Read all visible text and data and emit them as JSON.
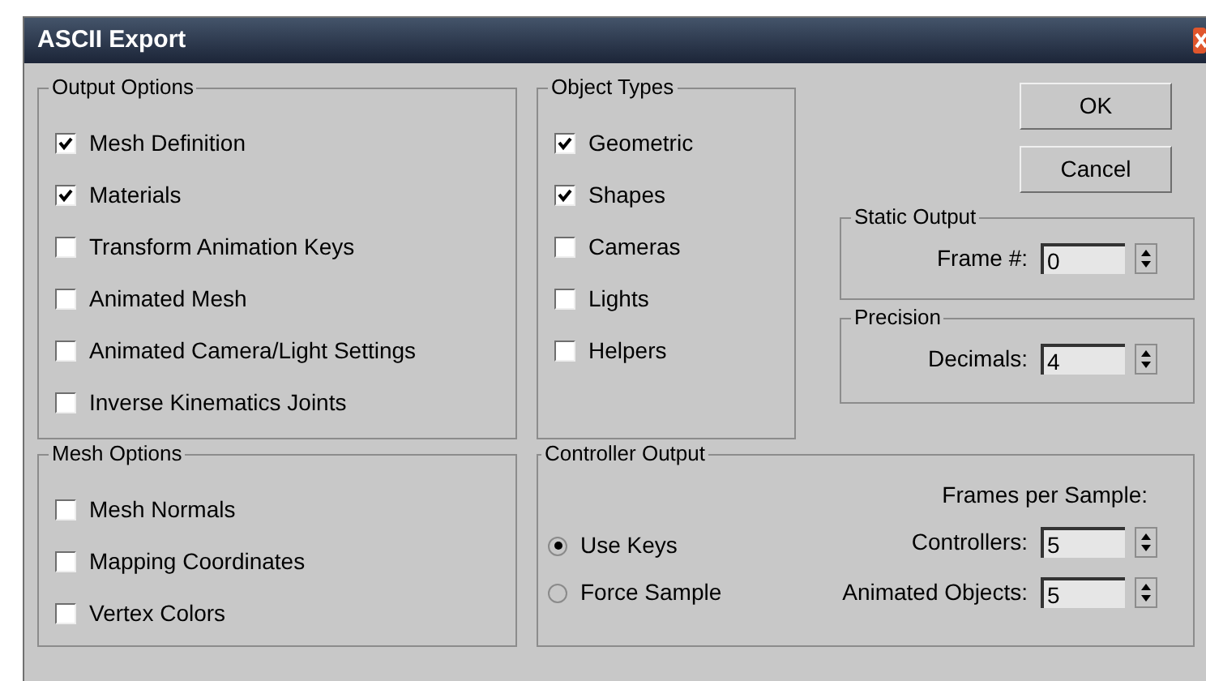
{
  "window": {
    "title": "ASCII Export"
  },
  "output_options": {
    "title": "Output Options",
    "items": [
      {
        "label": "Mesh Definition",
        "checked": true
      },
      {
        "label": "Materials",
        "checked": true
      },
      {
        "label": "Transform Animation Keys",
        "checked": false
      },
      {
        "label": "Animated Mesh",
        "checked": false
      },
      {
        "label": "Animated Camera/Light Settings",
        "checked": false
      },
      {
        "label": "Inverse Kinematics Joints",
        "checked": false
      }
    ]
  },
  "object_types": {
    "title": "Object Types",
    "items": [
      {
        "label": "Geometric",
        "checked": true
      },
      {
        "label": "Shapes",
        "checked": true
      },
      {
        "label": "Cameras",
        "checked": false
      },
      {
        "label": "Lights",
        "checked": false
      },
      {
        "label": "Helpers",
        "checked": false
      }
    ]
  },
  "buttons": [
    "OK",
    "Cancel"
  ],
  "static_output": {
    "title": "Static Output",
    "fields": [
      {
        "label": "Frame #:",
        "value": "0"
      }
    ]
  },
  "precision": {
    "title": "Precision",
    "fields": [
      {
        "label": "Decimals:",
        "value": "4"
      }
    ]
  },
  "mesh_options": {
    "title": "Mesh Options",
    "items": [
      {
        "label": "Mesh Normals",
        "checked": false
      },
      {
        "label": "Mapping Coordinates",
        "checked": false
      },
      {
        "label": "Vertex Colors",
        "checked": false
      }
    ]
  },
  "controller_output": {
    "title": "Controller Output",
    "caption": "Frames per Sample:",
    "radios": [
      {
        "label": "Use Keys",
        "selected": true
      },
      {
        "label": "Force Sample",
        "selected": false
      }
    ],
    "fields": [
      {
        "label": "Controllers:",
        "value": "5"
      },
      {
        "label": "Animated Objects:",
        "value": "5"
      }
    ]
  }
}
